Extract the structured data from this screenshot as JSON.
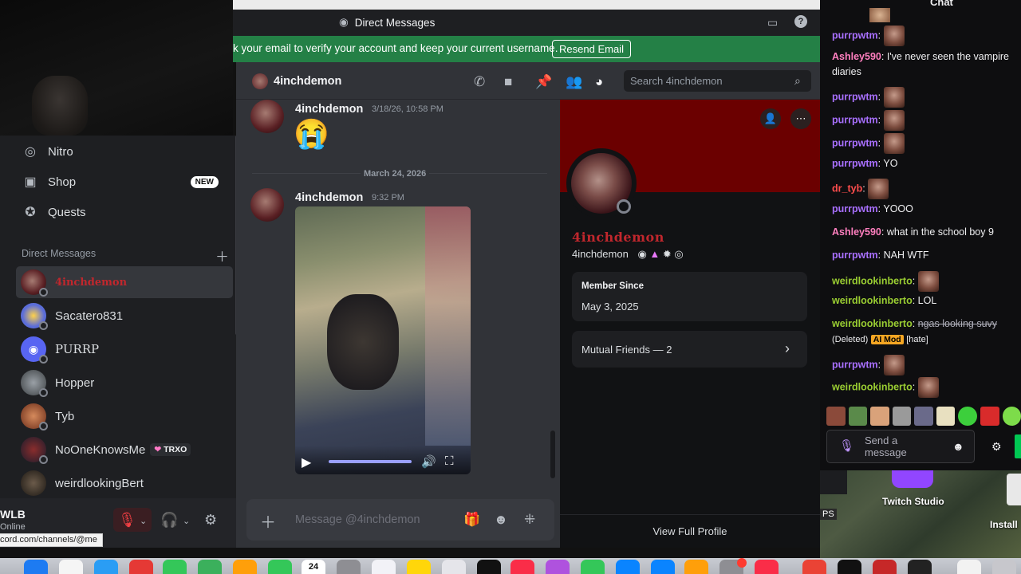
{
  "window_title": "Direct Messages",
  "verify_banner": {
    "text": "k your email to verify your account and keep your current username.",
    "button": "Resend Email"
  },
  "sidebar": {
    "nav": [
      {
        "label": "Nitro",
        "icon": "nitro-icon"
      },
      {
        "label": "Shop",
        "icon": "shop-icon",
        "badge": "NEW"
      },
      {
        "label": "Quests",
        "icon": "quests-icon"
      }
    ],
    "dm_header": "Direct Messages",
    "dms": [
      {
        "name": "4inchdemon",
        "active": true
      },
      {
        "name": "Sacatero831"
      },
      {
        "name": "PURRP"
      },
      {
        "name": "Hopper"
      },
      {
        "name": "Tyb"
      },
      {
        "name": "NoOneKnowsMe",
        "tag": "TRXO"
      },
      {
        "name": "weirdlookingBert"
      }
    ]
  },
  "user_panel": {
    "name": "WLB",
    "status": "Online",
    "url_tooltip": "cord.com/channels/@me"
  },
  "channel": {
    "title": "4inchdemon",
    "search_placeholder": "Search 4inchdemon"
  },
  "messages": [
    {
      "author": "4inchdemon",
      "time": "3/18/26, 10:58 PM",
      "content": "😭"
    },
    {
      "date_divider": "March 24, 2026"
    },
    {
      "author": "4inchdemon",
      "time": "9:32 PM",
      "content": "video"
    }
  ],
  "composer": {
    "placeholder": "Message @4inchdemon"
  },
  "profile": {
    "display_name": "4inchdemon",
    "username": "4inchdemon",
    "member_since_label": "Member Since",
    "member_since": "May 3, 2025",
    "mutual_friends": "Mutual Friends — 2",
    "view_full": "View Full Profile",
    "banner_color": "#6b0000",
    "name_color": "#c1272d"
  },
  "twitch_chat": {
    "title": "Chat",
    "messages": [
      {
        "user": "purrpwtm",
        "color": "#a970ff",
        "text": "",
        "emote": true
      },
      {
        "user": "Ashley590",
        "color": "#ff7fbf",
        "text": "I've never seen the vampire diaries"
      },
      {
        "user": "purrpwtm",
        "color": "#a970ff",
        "text": "",
        "emote": true
      },
      {
        "user": "purrpwtm",
        "color": "#a970ff",
        "text": "",
        "emote": true
      },
      {
        "user": "purrpwtm",
        "color": "#a970ff",
        "text": "",
        "emote": true
      },
      {
        "user": "purrpwtm",
        "color": "#a970ff",
        "text": "YO"
      },
      {
        "user": "dr_tyb",
        "color": "#ff4d4d",
        "text": "",
        "emote": true
      },
      {
        "user": "purrpwtm",
        "color": "#a970ff",
        "text": "YOOO"
      },
      {
        "user": "Ashley590",
        "color": "#ff7fbf",
        "text": "what in the school boy 9"
      },
      {
        "user": "purrpwtm",
        "color": "#a970ff",
        "text": "NAH WTF"
      },
      {
        "user": "weirdlookinberto",
        "color": "#9acd32",
        "text": "",
        "emote": true
      },
      {
        "user": "weirdlookinberto",
        "color": "#9acd32",
        "text": "LOL"
      },
      {
        "user": "weirdlookinberto",
        "color": "#9acd32",
        "deleted_text": "ngas looking suvy",
        "deleted_label": "(Deleted)",
        "badge": "AI Mod",
        "reason": "[hate]"
      },
      {
        "user": "purrpwtm",
        "color": "#a970ff",
        "text": "",
        "emote": true
      },
      {
        "user": "weirdlookinberto",
        "color": "#9acd32",
        "text": "",
        "emote": true
      }
    ],
    "input_placeholder": "Send a message"
  },
  "desktop": {
    "twitch_studio": "Twitch Studio",
    "install": "Install",
    "ps_label": "PS"
  },
  "dock_date": "24"
}
